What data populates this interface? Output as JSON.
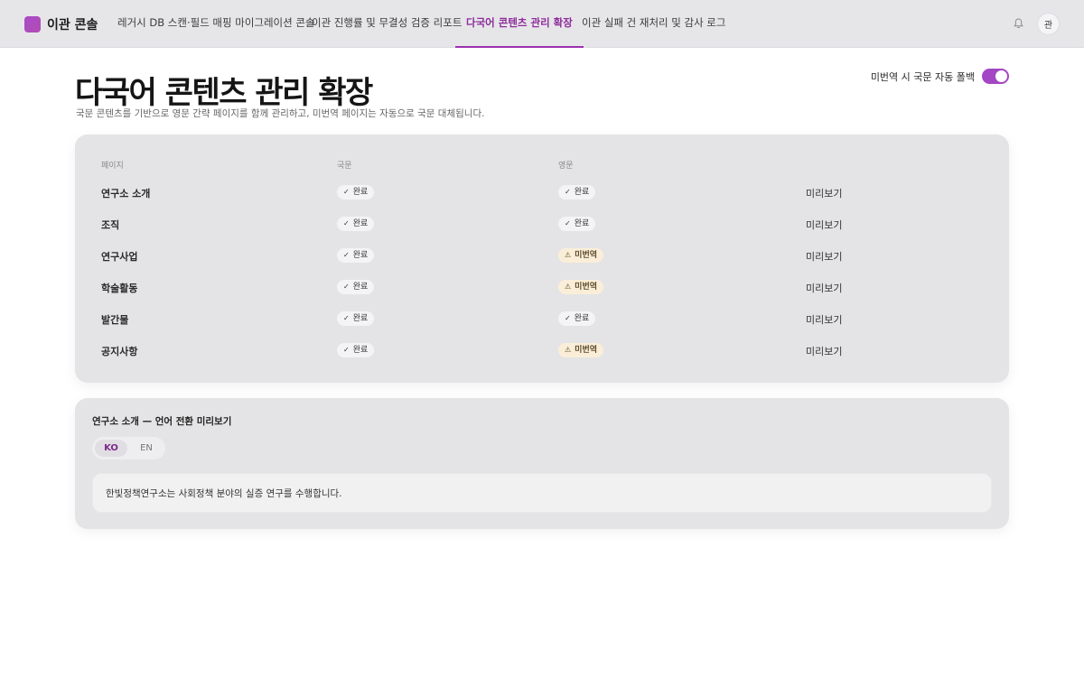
{
  "app": {
    "name": "이관 콘솔"
  },
  "nav": {
    "tabs": [
      {
        "label": "레거시 DB 스캔·필드 매핑 마이그레이션 콘솔"
      },
      {
        "label": "이관 진행률 및 무결성 검증 리포트"
      },
      {
        "label": "다국어 콘텐츠 관리 확장"
      },
      {
        "label": "이관 실패 건 재처리 및 감사 로그"
      }
    ],
    "active_index": 2,
    "avatar": "관",
    "bell_icon": "bell-icon"
  },
  "header": {
    "title": "다국어 콘텐츠 관리 확장",
    "subtitle": "국문 콘텐츠를 기반으로 영문 간략 페이지를 함께 관리하고, 미번역 페이지는 자동으로 국문 대체됩니다.",
    "fallback_label": "미번역 시 국문 자동 폴백",
    "fallback_on": true
  },
  "table": {
    "columns": [
      "페이지",
      "국문",
      "영문"
    ],
    "rows": [
      {
        "page": "연구소 소개",
        "ko": "완료",
        "en": "완료",
        "en_status": "done",
        "action": "미리보기"
      },
      {
        "page": "조직",
        "ko": "완료",
        "en": "완료",
        "en_status": "done",
        "action": "미리보기"
      },
      {
        "page": "연구사업",
        "ko": "완료",
        "en": "미번역",
        "en_status": "warn",
        "action": "미리보기"
      },
      {
        "page": "학술활동",
        "ko": "완료",
        "en": "미번역",
        "en_status": "warn",
        "action": "미리보기"
      },
      {
        "page": "발간물",
        "ko": "완료",
        "en": "완료",
        "en_status": "done",
        "action": "미리보기"
      },
      {
        "page": "공지사항",
        "ko": "완료",
        "en": "미번역",
        "en_status": "warn",
        "action": "미리보기"
      }
    ]
  },
  "preview": {
    "title": "연구소 소개 — 언어 전환 미리보기",
    "lang_ko": "KO",
    "lang_en": "EN",
    "active_lang": "KO",
    "content": "한빛정책연구소는 사회정책 분야의 실증 연구를 수행합니다."
  },
  "colors": {
    "accent": "#9b2fb0",
    "toggle": "#a347c4",
    "warn_bg": "#fbeed8"
  }
}
